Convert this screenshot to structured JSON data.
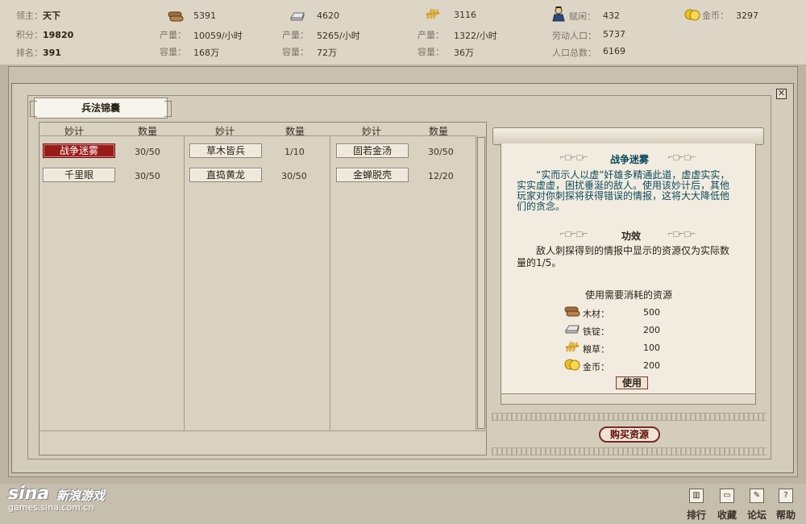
{
  "header": {
    "lord_label": "领主：",
    "lord_value": "天下",
    "score_label": "积分：",
    "score_value": "19820",
    "rank_label": "排名：",
    "rank_value": "391",
    "wood": {
      "icon": "wood-icon",
      "value": "5391",
      "prod_label": "产量：",
      "prod_value": "10059/小时",
      "cap_label": "容量：",
      "cap_value": "168万"
    },
    "iron": {
      "icon": "iron-ingot-icon",
      "value": "4620",
      "prod_label": "产量：",
      "prod_value": "5265/小时",
      "cap_label": "容量：",
      "cap_value": "72万"
    },
    "grain": {
      "icon": "grain-icon",
      "value": "3116",
      "prod_label": "产量：",
      "prod_value": "1322/小时",
      "cap_label": "容量：",
      "cap_value": "36万"
    },
    "population": {
      "icon": "idle-person-icon",
      "idle_label": "赋闲：",
      "idle_value": "432",
      "labor_label": "劳动人口：",
      "labor_value": "5737",
      "total_label": "人口总数：",
      "total_value": "6169"
    },
    "gold": {
      "icon": "gold-coin-icon",
      "label": "金币：",
      "value": "3297"
    }
  },
  "panel": {
    "title": "兵法锦囊",
    "close_symbol": "✕",
    "col_header_tactic": "妙计",
    "col_header_qty": "数量",
    "tactics": [
      {
        "name": "战争迷雾",
        "qty": "30/50",
        "active": true
      },
      {
        "name": "千里眼",
        "qty": "30/50"
      },
      {
        "name": "草木皆兵",
        "qty": "1/10"
      },
      {
        "name": "直捣黄龙",
        "qty": "30/50"
      },
      {
        "name": "固若金汤",
        "qty": "30/50"
      },
      {
        "name": "金蝉脱壳",
        "qty": "12/20"
      }
    ]
  },
  "detail": {
    "title": "战争迷雾",
    "description": "“实而示人以虚”奸雄多精通此道，虚虚实实，实实虚虚，困扰垂涎的敌人。使用该妙计后，其他玩家对你刺探将获得错误的情报，这将大大降低他们的贪念。",
    "effect_title": "功效",
    "effect_text": "敌人刺探得到的情报中显示的资源仅为实际数量的1/5。",
    "cost_header": "使用需要消耗的资源",
    "costs": [
      {
        "label": "木材：",
        "value": "500",
        "icon": "wood-icon"
      },
      {
        "label": "铁锭：",
        "value": "200",
        "icon": "iron-ingot-icon"
      },
      {
        "label": "粮草：",
        "value": "100",
        "icon": "grain-icon"
      },
      {
        "label": "金币：",
        "value": "200",
        "icon": "gold-coin-icon"
      }
    ],
    "use_label": "使用",
    "buy_label": "购买资源"
  },
  "footer": {
    "logo_big": "sina",
    "logo_cn": "新浪游戏",
    "logo_url": "games.sina.com.cn",
    "buttons": [
      {
        "label": "排行",
        "icon": "ranking-icon"
      },
      {
        "label": "收藏",
        "icon": "bookmark-folder-icon"
      },
      {
        "label": "论坛",
        "icon": "forum-icon"
      },
      {
        "label": "帮助",
        "icon": "help-icon"
      }
    ]
  },
  "colors": {
    "active_red": "#9a1c1a",
    "desc_teal": "#0d4a5e",
    "panel_bg": "#d5cdbb"
  }
}
